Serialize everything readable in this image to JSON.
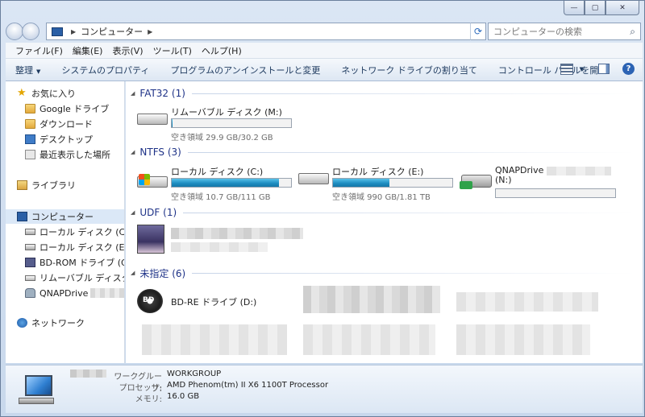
{
  "window": {
    "caption": {
      "minimize": "—",
      "maximize": "▢",
      "close": "✕"
    }
  },
  "address": {
    "location": "コンピューター",
    "search_placeholder": "コンピューターの検索"
  },
  "menu": [
    "ファイル(F)",
    "編集(E)",
    "表示(V)",
    "ツール(T)",
    "ヘルプ(H)"
  ],
  "commands": {
    "organize": "整理",
    "system_properties": "システムのプロパティ",
    "uninstall": "プログラムのアンインストールと変更",
    "map_drive": "ネットワーク ドライブの割り当て",
    "control_panel": "コントロール パネルを開く"
  },
  "nav": {
    "favorites": "お気に入り",
    "fav_items": [
      "Google ドライブ",
      "ダウンロード",
      "デスクトップ",
      "最近表示した場所"
    ],
    "libraries": "ライブラリ",
    "computer": "コンピューター",
    "computer_items": [
      "ローカル ディスク (C:)",
      "ローカル ディスク (E:)",
      "BD-ROM ドライブ (G:) ",
      "リムーバブル ディスク (",
      "QNAPDrive"
    ],
    "network": "ネットワーク"
  },
  "groups": {
    "fat32": "FAT32 (1)",
    "ntfs": "NTFS (3)",
    "udf": "UDF (1)",
    "unspecified": "未指定 (6)"
  },
  "drives": {
    "m": {
      "name": "リムーバブル ディスク (M:)",
      "info": "空き領域 29.9 GB/30.2 GB",
      "used_fraction": 0.01
    },
    "c": {
      "name": "ローカル ディスク (C:)",
      "info": "空き領域 10.7 GB/111 GB",
      "used_fraction": 0.9
    },
    "e": {
      "name": "ローカル ディスク (E:)",
      "info": "空き領域 990 GB/1.81 TB",
      "used_fraction": 0.47
    },
    "n": {
      "name": "QNAPDrive",
      "name2": "(N:)",
      "used_fraction": 0.0
    },
    "d": {
      "name": "BD-RE ドライブ (D:)",
      "icon_label": "BD"
    }
  },
  "details": {
    "workgroup_label": "ワークグループ:",
    "workgroup": "WORKGROUP",
    "processor_label": "プロセッサ:",
    "processor": "AMD Phenom(tm) II X6 1100T Processor",
    "memory_label": "メモリ:",
    "memory": "16.0 GB"
  },
  "icons": {
    "favorites": "star-icon",
    "computer": "computer-icon",
    "network": "network-icon"
  }
}
